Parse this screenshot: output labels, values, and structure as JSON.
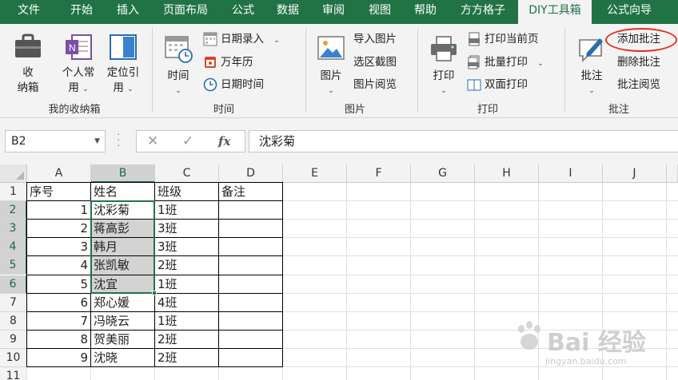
{
  "tabs": [
    {
      "label": "文件"
    },
    {
      "label": "开始"
    },
    {
      "label": "插入"
    },
    {
      "label": "页面布局"
    },
    {
      "label": "公式"
    },
    {
      "label": "数据"
    },
    {
      "label": "审阅"
    },
    {
      "label": "视图"
    },
    {
      "label": "帮助"
    },
    {
      "label": "方方格子"
    },
    {
      "label": "DIY工具箱"
    },
    {
      "label": "公式向导"
    }
  ],
  "active_tab": "DIY工具箱",
  "ribbon": {
    "storage_group": {
      "label": "我的收纳箱",
      "storage_box_line1": "收",
      "storage_box_line2": "纳箱",
      "personal_line1": "个人常",
      "personal_line2": "用",
      "locate_line1": "定位引",
      "locate_line2": "用"
    },
    "time_group": {
      "label": "时间",
      "time_button": "时间",
      "date_entry": "日期录入",
      "calendar": "万年历",
      "date_time": "日期时间"
    },
    "picture_group": {
      "label": "图片",
      "picture_button": "图片",
      "import_picture": "导入图片",
      "selection_screenshot": "选区截图",
      "picture_browse": "图片阅览"
    },
    "print_group": {
      "label": "打印",
      "print_button": "打印",
      "print_current_page": "打印当前页",
      "batch_print": "批量打印",
      "duplex_print": "双面打印"
    },
    "comment_group": {
      "label": "批注",
      "comment_button": "批注",
      "add_comment": "添加批注",
      "delete_comment": "删除批注",
      "comment_browse": "批注阅览"
    }
  },
  "formula_bar": {
    "name_box": "B2",
    "cancel_symbol": "✕",
    "enter_symbol": "✓",
    "fx_label": "fx",
    "content": "沈彩菊"
  },
  "sheet": {
    "columns": [
      "A",
      "B",
      "C",
      "D",
      "E",
      "F",
      "G",
      "H",
      "I",
      "J"
    ],
    "rows": [
      "1",
      "2",
      "3",
      "4",
      "5",
      "6",
      "7",
      "8",
      "9",
      "10",
      "11"
    ],
    "header": {
      "seq": "序号",
      "name": "姓名",
      "class": "班级",
      "note": "备注"
    },
    "data": [
      {
        "seq": "1",
        "name": "沈彩菊",
        "class": "1班",
        "note": ""
      },
      {
        "seq": "2",
        "name": "蒋高彭",
        "class": "3班",
        "note": ""
      },
      {
        "seq": "3",
        "name": "韩月",
        "class": "3班",
        "note": ""
      },
      {
        "seq": "4",
        "name": "张凯敏",
        "class": "2班",
        "note": ""
      },
      {
        "seq": "5",
        "name": "沈宜",
        "class": "1班",
        "note": ""
      },
      {
        "seq": "6",
        "name": "郑心媛",
        "class": "4班",
        "note": ""
      },
      {
        "seq": "7",
        "name": "冯晓云",
        "class": "1班",
        "note": ""
      },
      {
        "seq": "8",
        "name": "贺美丽",
        "class": "2班",
        "note": ""
      },
      {
        "seq": "9",
        "name": "沈晓",
        "class": "2班",
        "note": ""
      }
    ]
  },
  "watermark": {
    "main": "Bai 经验",
    "sub": "jingyan.baidu.com"
  },
  "colors": {
    "excel_green": "#217346",
    "highlight_red": "#e03222",
    "selection_gray": "#d3d3d3"
  }
}
